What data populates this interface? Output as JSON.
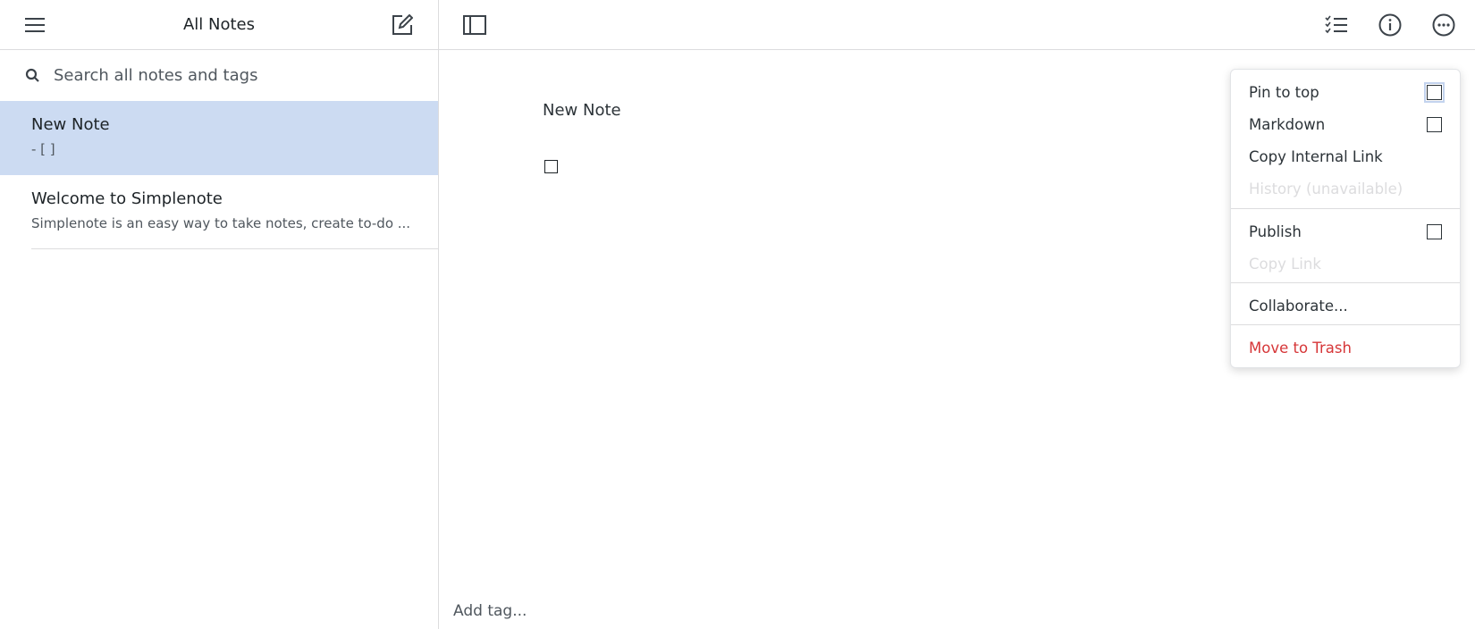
{
  "sidebar": {
    "title": "All Notes",
    "search_placeholder": "Search all notes and tags",
    "notes": [
      {
        "title": "New Note",
        "preview": "- [ ]"
      },
      {
        "title": "Welcome to Simplenote",
        "preview": "Simplenote is an easy way to take notes, create to-do ..."
      }
    ]
  },
  "editor": {
    "title": "New Note",
    "add_tag": "Add tag..."
  },
  "menu": {
    "pin": "Pin to top",
    "markdown": "Markdown",
    "copy_internal": "Copy Internal Link",
    "history": "History (unavailable)",
    "publish": "Publish",
    "copy_link": "Copy Link",
    "collaborate": "Collaborate...",
    "trash": "Move to Trash"
  }
}
